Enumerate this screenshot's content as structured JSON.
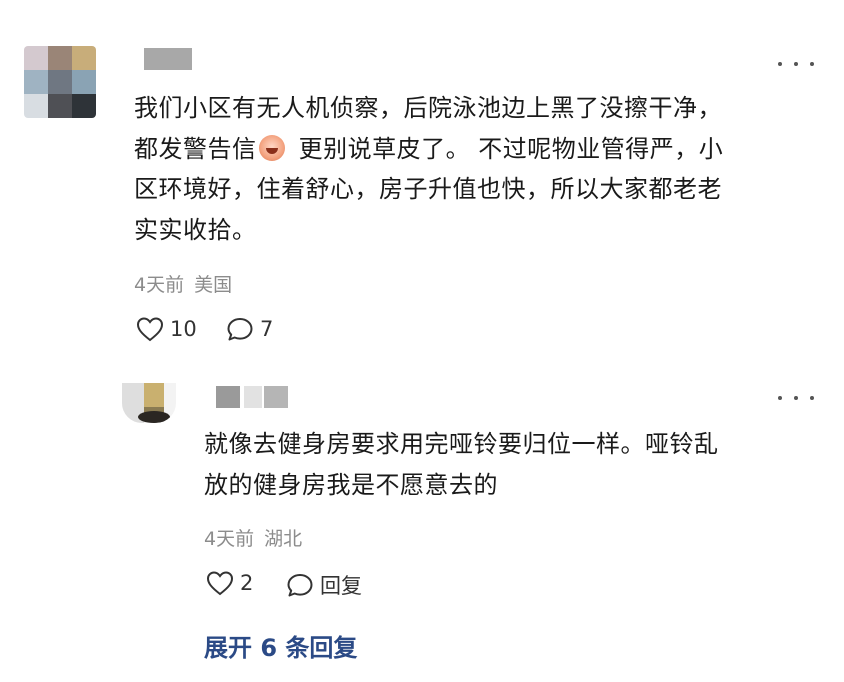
{
  "comment": {
    "text_line1": "我们小区有无人机侦察，后院泳池边上黑了没擦干净，",
    "text_line2_a": "都发警告信",
    "emoji": "crying-face-emoji",
    "text_line2_b": " 更别说草皮了。 不过呢物业管得严，小",
    "text_line3": "区环境好，住着舒心，房子升值也快，所以大家都老老",
    "text_line4": "实实收拾。",
    "time": "4天前",
    "location": "美国",
    "likes": "10",
    "replies": "7"
  },
  "reply": {
    "text_line1": "就像去健身房要求用完哑铃要归位一样。哑铃乱",
    "text_line2": "放的健身房我是不愿意去的",
    "time": "4天前",
    "location": "湖北",
    "likes": "2",
    "reply_label": "回复"
  },
  "expand_label": "展开 6 条回复",
  "colors": {
    "link_blue": "#2b4a86",
    "meta_gray": "#8c8c8c",
    "blur_gray": "#a8a8a8"
  }
}
